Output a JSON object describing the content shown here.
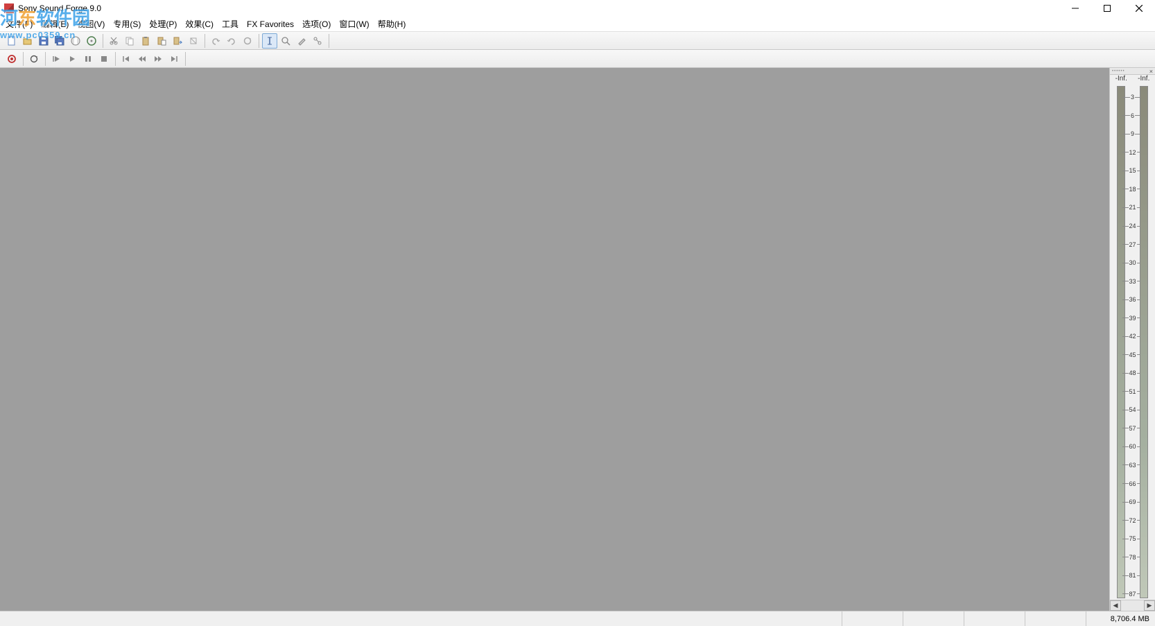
{
  "window": {
    "title": "Sony Sound Forge 9.0"
  },
  "watermark": {
    "line1_pre": "河",
    "line1_orange": "东",
    "line1_post": "软件园",
    "line2": "www.pc0359.cn"
  },
  "menu": {
    "file": "文件(F)",
    "edit": "编辑(E)",
    "view": "视图(V)",
    "special": "专用(S)",
    "process": "处理(P)",
    "effects": "效果(C)",
    "tools": "工具",
    "fxfav": "FX Favorites",
    "options": "选项(O)",
    "window": "窗口(W)",
    "help": "帮助(H)"
  },
  "meter": {
    "left_label": "-Inf.",
    "right_label": "-Inf.",
    "ticks": [
      "3",
      "6",
      "9",
      "12",
      "15",
      "18",
      "21",
      "24",
      "27",
      "30",
      "33",
      "36",
      "39",
      "42",
      "45",
      "48",
      "51",
      "54",
      "57",
      "60",
      "63",
      "66",
      "69",
      "72",
      "75",
      "78",
      "81",
      "87"
    ]
  },
  "status": {
    "memory": "8,706.4 MB"
  }
}
